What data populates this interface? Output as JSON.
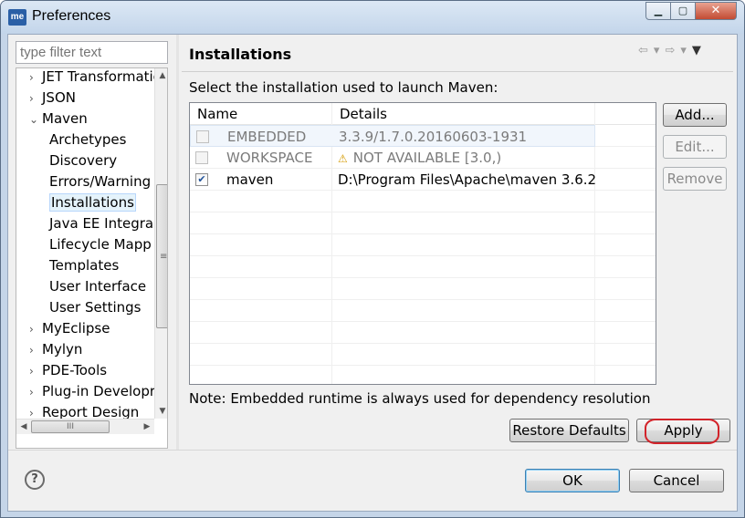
{
  "window": {
    "icon_text": "me",
    "title": "Preferences",
    "buttons": {
      "minimize": "▁",
      "maximize": "▢",
      "close": "✕"
    }
  },
  "filter": {
    "placeholder": "type filter text"
  },
  "tree": {
    "items": [
      {
        "label": "JET Transformatio",
        "arrow": "›"
      },
      {
        "label": "JSON",
        "arrow": "›"
      },
      {
        "label": "Maven",
        "arrow": "⌄"
      },
      {
        "label": "Archetypes"
      },
      {
        "label": "Discovery"
      },
      {
        "label": "Errors/Warning"
      },
      {
        "label": "Installations"
      },
      {
        "label": "Java EE Integra"
      },
      {
        "label": "Lifecycle Mapp"
      },
      {
        "label": "Templates"
      },
      {
        "label": "User Interface"
      },
      {
        "label": "User Settings"
      },
      {
        "label": "MyEclipse",
        "arrow": "›"
      },
      {
        "label": "Mylyn",
        "arrow": "›"
      },
      {
        "label": "PDE-Tools",
        "arrow": "›"
      },
      {
        "label": "Plug-in Developr",
        "arrow": "›"
      },
      {
        "label": "Report Design",
        "arrow": "›"
      }
    ],
    "selected": "Installations",
    "hscroll_grip": "III"
  },
  "page": {
    "title": "Installations",
    "description": "Select the installation used to launch Maven:",
    "columns": [
      "Name",
      "Details"
    ],
    "rows": [
      {
        "checked": false,
        "name": "EMBEDDED",
        "details": "3.3.9/1.7.0.20160603-1931",
        "disabled": true
      },
      {
        "checked": false,
        "name": "WORKSPACE",
        "details": "NOT AVAILABLE [3.0,)",
        "disabled": true,
        "warning": true
      },
      {
        "checked": true,
        "name": "maven",
        "details": "D:\\Program Files\\Apache\\maven 3.6.2",
        "disabled": false
      }
    ],
    "note": "Note: Embedded runtime is always used for dependency resolution"
  },
  "buttons": {
    "add": "Add...",
    "edit": "Edit...",
    "remove": "Remove",
    "restore_defaults": "Restore Defaults",
    "apply": "Apply",
    "ok": "OK",
    "cancel": "Cancel",
    "help": "?"
  },
  "colors": {
    "highlight_ring": "#d2232a",
    "selection": "#e5f3fb"
  }
}
